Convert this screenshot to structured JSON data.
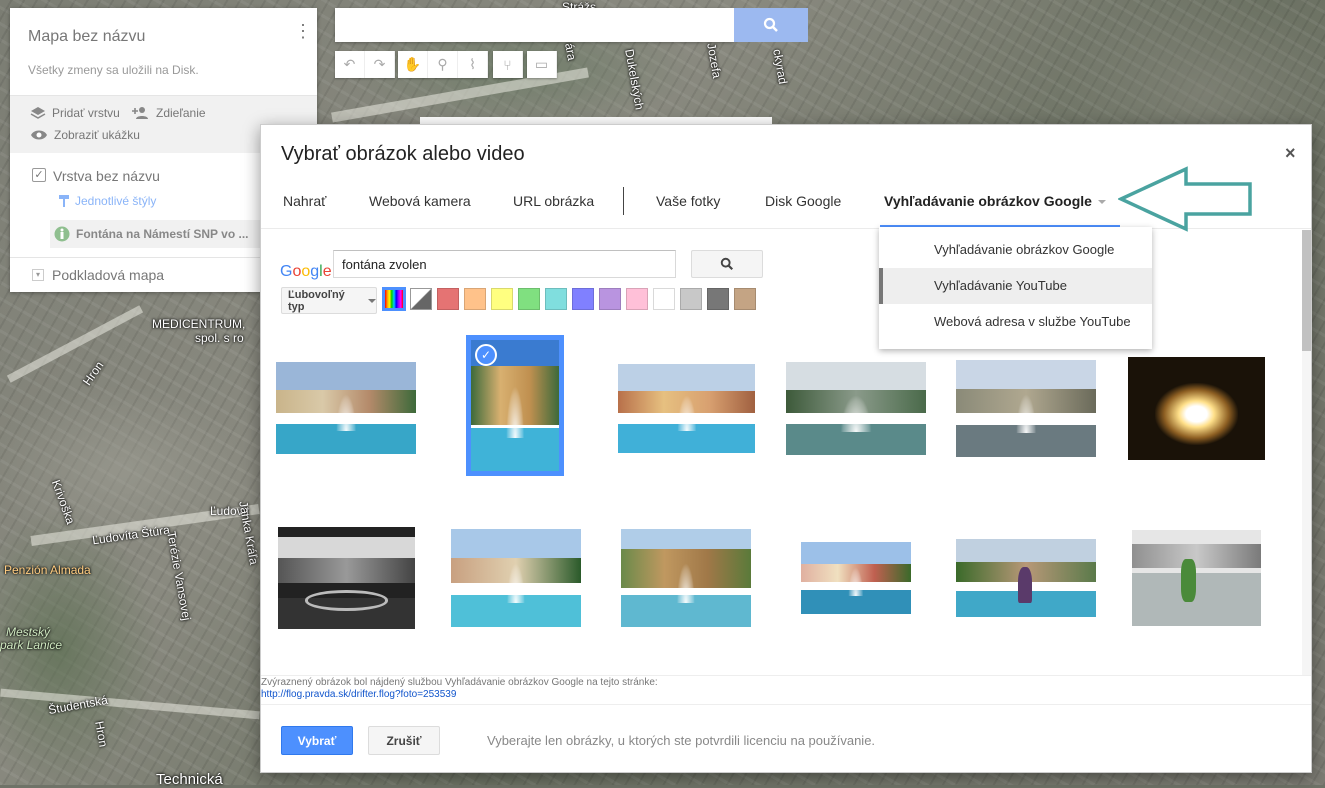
{
  "map": {
    "labels": {
      "medicentrum": "MEDICENTRUM,",
      "medicentrum2": "spol. s ro",
      "hron": "Hron",
      "krivoska": "Krivoška",
      "ludovita_stura": "Ľudovíta Štúra",
      "ludovita2": "Ľudovít",
      "terezie": "Terézie Vansovej",
      "janka": "Janka Kráľa",
      "penzion": "Penzión Almada",
      "mestsky": "Mestský",
      "park": "park Lanice",
      "studentska": "Študentská",
      "hron2": "Hron",
      "technicka": "Technická",
      "dukelskych": "Dukelských",
      "jozefa": "Jozefa",
      "strazska": "Strážs",
      "ckyrad": "ckyrad",
      "ara": "ára"
    }
  },
  "left_panel": {
    "title": "Mapa bez názvu",
    "saved": "Všetky zmeny sa uložili na Disk.",
    "add_layer": "Pridať vrstvu",
    "share": "Zdieľanie",
    "preview": "Zobraziť ukážku",
    "layer_name": "Vrstva bez názvu",
    "styles": "Jednotlivé štýly",
    "feature": "Fontána na Námestí SNP vo ...",
    "base_map": "Podkladová mapa"
  },
  "dialog": {
    "title": "Vybrať obrázok alebo video",
    "close": "×",
    "tabs": [
      "Nahrať",
      "Webová kamera",
      "URL obrázka",
      "Vaše fotky",
      "Disk Google",
      "Vyhľadávanie obrázkov Google"
    ],
    "google_logo": "Google",
    "search_value": "fontána zvolen",
    "type_select": "Ľubovoľný typ",
    "swatch_colors": [
      "#e57373",
      "#ffc28a",
      "#ffff80",
      "#80e080",
      "#80dede",
      "#8080ff",
      "#b994e0",
      "#ffc0d8",
      "#ffffff",
      "#c8c8c8",
      "#777777",
      "#c4a484"
    ],
    "attribution_text": "Zvýraznený obrázok bol nájdený službou Vyhľadávanie obrázkov Google na tejto stránke:",
    "attribution_link": "http://flog.pravda.sk/drifter.flog?foto=253539",
    "select_button": "Vybrať",
    "cancel_button": "Zrušiť",
    "license_note": "Vyberajte len obrázky, u ktorých ste potvrdili licenciu na používanie."
  },
  "dropdown": {
    "items": [
      "Vyhľadávanie obrázkov Google",
      "Vyhľadávanie YouTube",
      "Webová adresa v službe YouTube"
    ]
  },
  "accent_color": "#4d90fe",
  "arrow_color": "#4aa3a0"
}
